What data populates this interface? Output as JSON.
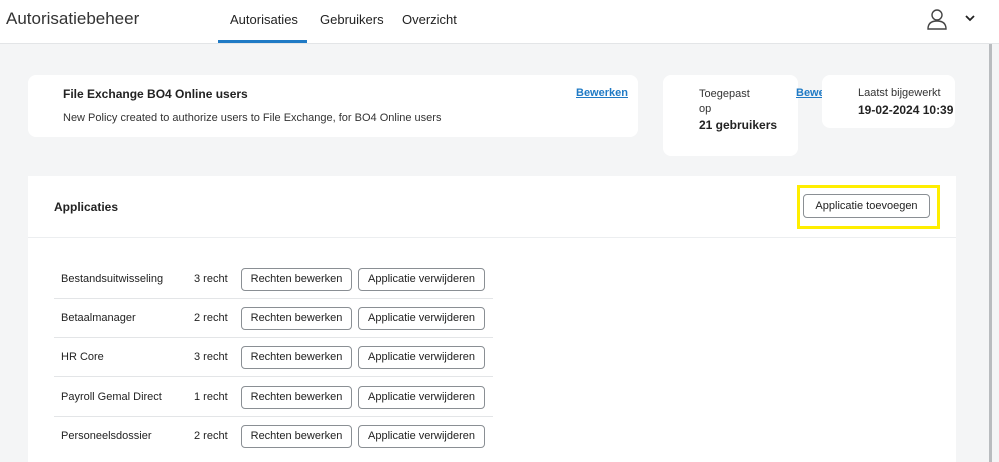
{
  "header": {
    "app_title": "Autorisatiebeheer",
    "tabs": [
      {
        "label": "Autorisaties",
        "active": true
      },
      {
        "label": "Gebruikers",
        "active": false
      },
      {
        "label": "Overzicht",
        "active": false
      }
    ],
    "user_icon": "user-icon",
    "menu_icon": "chevron-down-icon",
    "accent_color": "#1f7ac5"
  },
  "policy": {
    "title": "File Exchange BO4 Online users",
    "description": "New Policy created to authorize users to File Exchange, for BO4 Online users",
    "edit_label": "Bewerken"
  },
  "applied": {
    "label": "Toegepast op",
    "count": "21 gebruikers",
    "edit_label": "Bewerken"
  },
  "updated": {
    "label": "Laatst bijgewerkt",
    "value": "19-02-2024 10:39"
  },
  "applications": {
    "title": "Applicaties",
    "add_button": "Applicatie toevoegen",
    "highlight_color": "#ffee00",
    "rows": [
      {
        "name": "Bestandsuitwisseling",
        "rights": "3 recht",
        "edit": "Rechten bewerken",
        "remove": "Applicatie verwijderen"
      },
      {
        "name": "Betaalmanager",
        "rights": "2 recht",
        "edit": "Rechten bewerken",
        "remove": "Applicatie verwijderen"
      },
      {
        "name": "HR Core",
        "rights": "3 recht",
        "edit": "Rechten bewerken",
        "remove": "Applicatie verwijderen"
      },
      {
        "name": "Payroll Gemal Direct",
        "rights": "1 recht",
        "edit": "Rechten bewerken",
        "remove": "Applicatie verwijderen"
      },
      {
        "name": "Personeelsdossier",
        "rights": "2 recht",
        "edit": "Rechten bewerken",
        "remove": "Applicatie verwijderen"
      }
    ]
  }
}
